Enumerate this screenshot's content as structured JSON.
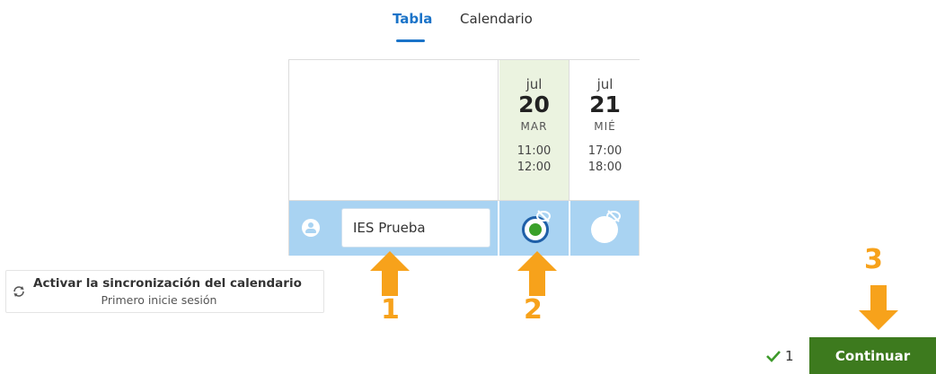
{
  "tabs": [
    {
      "label": "Tabla",
      "active": true
    },
    {
      "label": "Calendario",
      "active": false
    }
  ],
  "columns": [
    {
      "month": "jul",
      "day": "20",
      "weekday": "MAR",
      "start": "11:00",
      "end": "12:00",
      "highlighted": true
    },
    {
      "month": "jul",
      "day": "21",
      "weekday": "MIÉ",
      "start": "17:00",
      "end": "18:00",
      "highlighted": false
    }
  ],
  "participant": {
    "name_value": "IES Prueba",
    "icon": "user-circle-icon"
  },
  "votes": [
    {
      "state": "selected",
      "icon": "eye-off-icon"
    },
    {
      "state": "unselected",
      "icon": "eye-off-icon"
    }
  ],
  "sync": {
    "title": "Activar la sincronización del calendario",
    "subtitle": "Primero inicie sesión",
    "icon": "sync-icon"
  },
  "annotations": {
    "step1": "1",
    "step2": "2",
    "step3": "3",
    "arrow_color": "#f7a21b"
  },
  "footer": {
    "check_count": "1",
    "continue_label": "Continuar",
    "button_color": "#3d7a1e"
  },
  "colors": {
    "accent": "#1a73c8",
    "row_bg": "#a9d3f2",
    "highlight_col": "#ebf3e0"
  }
}
